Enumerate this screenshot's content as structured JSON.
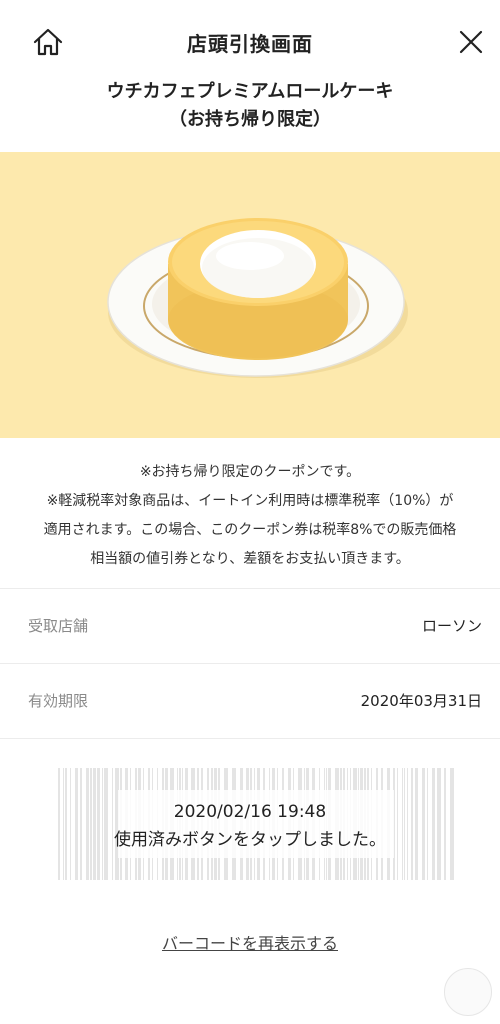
{
  "header": {
    "title": "店頭引換画面",
    "home_icon": "home-icon",
    "close_icon": "close-icon"
  },
  "product": {
    "name": "ウチカフェプレミアムロールケーキ",
    "subtitle": "（お持ち帰り限定）",
    "image": "roll-cake-on-plate"
  },
  "notice": {
    "line1": "※お持ち帰り限定のクーポンです。",
    "line2": "※軽減税率対象商品は、イートイン利用時は標準税率（10%）が",
    "line3": "適用されます。この場合、このクーポン券は税率8%での販売価格",
    "line4": "相当額の値引券となり、差額をお支払い頂きます。"
  },
  "details": {
    "store_label": "受取店舗",
    "store_value": "ローソン",
    "expiry_label": "有効期限",
    "expiry_value": "2020年03月31日"
  },
  "barcode": {
    "used_datetime": "2020/02/16 19:48",
    "used_message": "使用済みボタンをタップしました。",
    "redisplay_label": "バーコードを再表示する"
  },
  "colors": {
    "hero_background": "#fde9ad",
    "divider": "#ececec"
  }
}
